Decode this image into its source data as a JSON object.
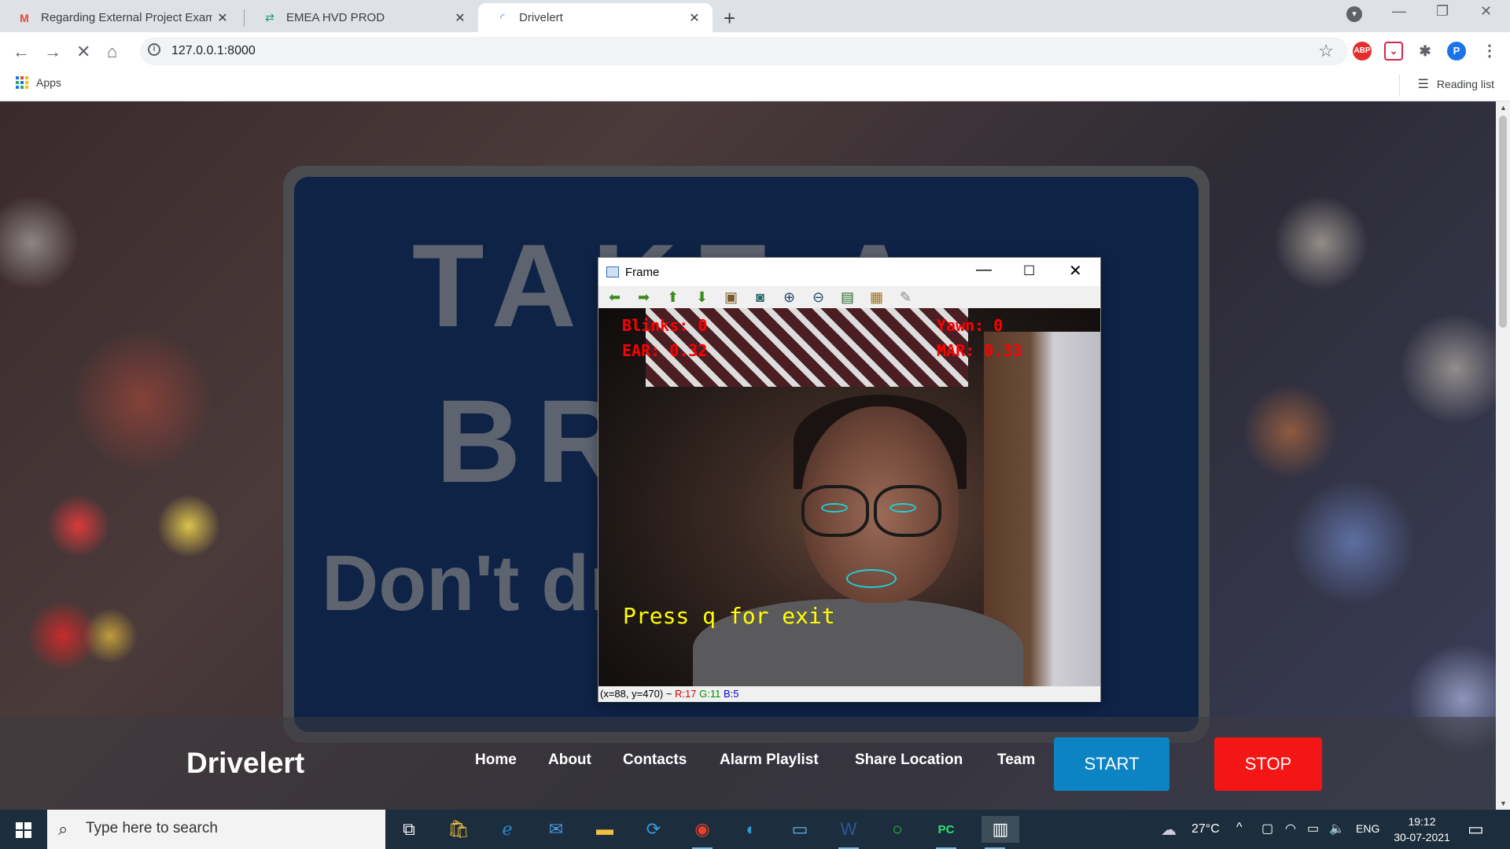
{
  "tabs": [
    {
      "icon": "gmail-icon",
      "title": "Regarding External Project Exami",
      "active": false
    },
    {
      "icon": "emea-icon",
      "title": "EMEA HVD PROD",
      "active": false
    },
    {
      "icon": "loading-icon",
      "title": "Drivelert",
      "active": true
    }
  ],
  "toolbar": {
    "url": "127.0.0.1:8000"
  },
  "bookmarks": {
    "apps_label": "Apps",
    "reading_list_label": "Reading list"
  },
  "extensions": {
    "abp_label": "ABP",
    "profile_initial": "P"
  },
  "background_sign": {
    "line1": "TAKE A",
    "line2": "BREAK",
    "line3": "Don't drive sleepy."
  },
  "site_nav": {
    "brand": "Drivelert",
    "links": [
      "Home",
      "About",
      "Contacts",
      "Alarm Playlist",
      "Share Location",
      "Team"
    ],
    "start_label": "START",
    "stop_label": "STOP"
  },
  "frame_window": {
    "title": "Frame",
    "blinks": "Blinks: 0",
    "yawn": "Yawn: 0",
    "ear": "EAR: 0.32",
    "mar": "MAR: 0.33",
    "press_text": "Press q for exit",
    "status_pos": "(x=88, y=470) ~ ",
    "status_r": "R:17",
    "status_g": "G:11",
    "status_b": "B:5"
  },
  "taskbar": {
    "search_placeholder": "Type here to search",
    "temperature": "27°C",
    "language": "ENG",
    "time": "19:12",
    "date": "30-07-2021"
  },
  "colors": {
    "start": "#0c84c4",
    "stop": "#f41515",
    "overlay_red": "#ff0000",
    "overlay_yellow": "#ffff00",
    "landmark": "#1ad3d8"
  }
}
